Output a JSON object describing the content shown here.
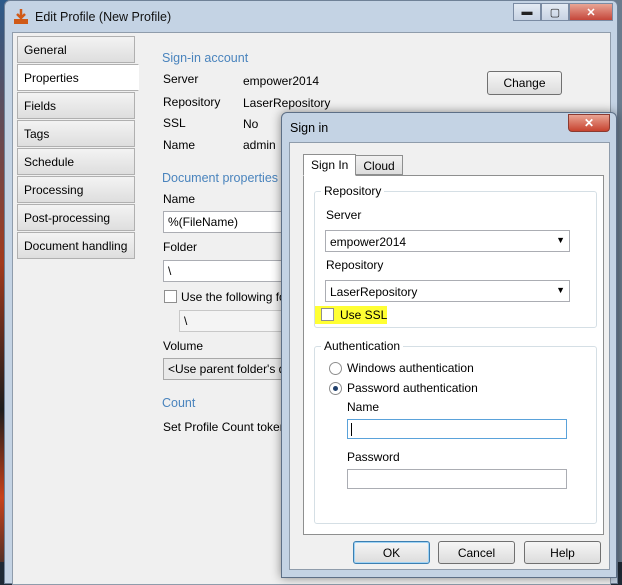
{
  "main_window": {
    "title": "Edit Profile (New Profile)",
    "controls": {
      "minimize": "▬",
      "maximize": "▢",
      "close": "✕"
    },
    "side_tabs": [
      "General",
      "Properties",
      "Fields",
      "Tags",
      "Schedule",
      "Processing",
      "Post-processing",
      "Document handling"
    ],
    "active_tab": "Properties",
    "signin": {
      "title": "Sign-in account",
      "server_label": "Server",
      "server_value": "empower2014",
      "repository_label": "Repository",
      "repository_value": "LaserRepository",
      "ssl_label": "SSL",
      "ssl_value": "No",
      "name_label": "Name",
      "name_value": "admin",
      "change_button": "Change"
    },
    "docprops": {
      "title": "Document properties",
      "name_label": "Name",
      "name_value": "%(FileName)",
      "folder_label": "Folder",
      "folder_value": "\\",
      "use_following_label": "Use the following fold",
      "sub_folder_value": "\\",
      "volume_label": "Volume",
      "volume_value": "<Use parent folder's d"
    },
    "count": {
      "title": "Count",
      "set_label": "Set Profile Count toker"
    }
  },
  "signin_dialog": {
    "title": "Sign in",
    "close": "✕",
    "tabs": [
      "Sign In",
      "Cloud"
    ],
    "repository_group": {
      "title": "Repository",
      "server_label": "Server",
      "server_value": "empower2014",
      "repository_label": "Repository",
      "repository_value": "LaserRepository",
      "ssl_label": "Use SSL",
      "ssl_checked": false
    },
    "auth_group": {
      "title": "Authentication",
      "windows_label": "Windows authentication",
      "password_label": "Password authentication",
      "selected": "Password authentication",
      "name_label": "Name",
      "name_value": "",
      "password_field_label": "Password",
      "password_value": ""
    },
    "buttons": {
      "ok": "OK",
      "cancel": "Cancel",
      "help": "Help"
    }
  },
  "colors": {
    "section_title": "#4a84bd",
    "highlight": "#ffff33",
    "titlebar": "#c4d3e4"
  }
}
